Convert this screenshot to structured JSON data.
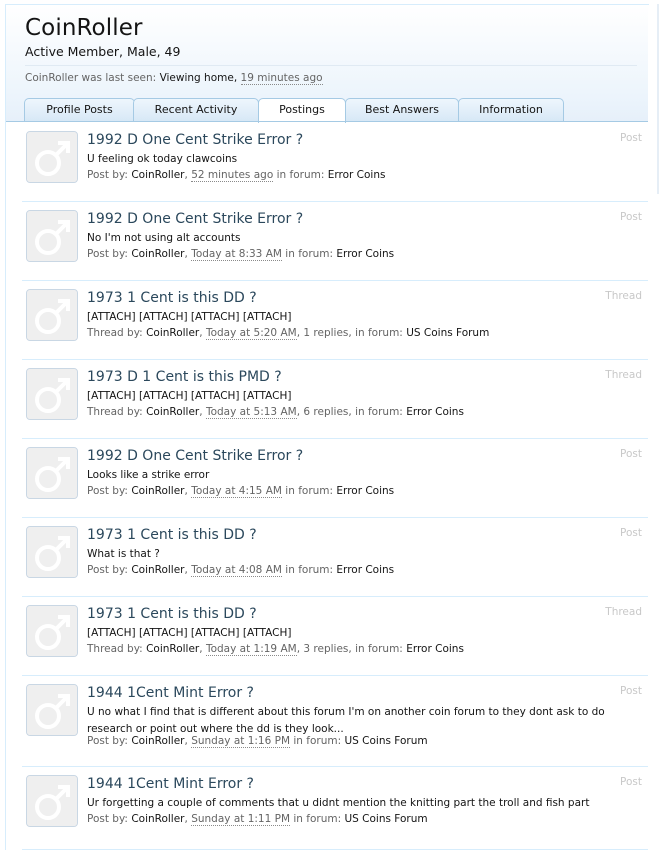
{
  "profile": {
    "username": "CoinRoller",
    "user_title": "Active Member, Male, 49",
    "last_seen_prefix": "CoinRoller was last seen:",
    "last_seen_activity": "Viewing home,",
    "last_seen_time": "19 minutes ago"
  },
  "tabs": [
    {
      "label": "Profile Posts"
    },
    {
      "label": "Recent Activity"
    },
    {
      "label": "Postings"
    },
    {
      "label": "Best Answers"
    },
    {
      "label": "Information"
    }
  ],
  "active_tab": "Postings",
  "items": [
    {
      "title": "1992 D One Cent Strike Error ?",
      "snippet": "U feeling ok today clawcoins",
      "by_label": "Post by:",
      "author": "CoinRoller",
      "time": "52 minutes ago",
      "replies": "",
      "forum_label": "in forum:",
      "forum": "Error Coins",
      "type": "Post"
    },
    {
      "title": "1992 D One Cent Strike Error ?",
      "snippet": "No I'm not using alt accounts",
      "by_label": "Post by:",
      "author": "CoinRoller",
      "time": "Today at 8:33 AM",
      "replies": "",
      "forum_label": "in forum:",
      "forum": "Error Coins",
      "type": "Post"
    },
    {
      "title": "1973 1 Cent is this DD ?",
      "snippet": "[ATTACH] [ATTACH] [ATTACH] [ATTACH]",
      "by_label": "Thread by:",
      "author": "CoinRoller",
      "time": "Today at 5:20 AM",
      "replies": "1 replies,",
      "forum_label": "in forum:",
      "forum": "US Coins Forum",
      "type": "Thread"
    },
    {
      "title": "1973 D 1 Cent is this PMD ?",
      "snippet": "[ATTACH] [ATTACH] [ATTACH] [ATTACH]",
      "by_label": "Thread by:",
      "author": "CoinRoller",
      "time": "Today at 5:13 AM",
      "replies": "6 replies,",
      "forum_label": "in forum:",
      "forum": "Error Coins",
      "type": "Thread"
    },
    {
      "title": "1992 D One Cent Strike Error ?",
      "snippet": "Looks like a strike error",
      "by_label": "Post by:",
      "author": "CoinRoller",
      "time": "Today at 4:15 AM",
      "replies": "",
      "forum_label": "in forum:",
      "forum": "Error Coins",
      "type": "Post"
    },
    {
      "title": "1973 1 Cent is this DD ?",
      "snippet": "What is that ?",
      "by_label": "Post by:",
      "author": "CoinRoller",
      "time": "Today at 4:08 AM",
      "replies": "",
      "forum_label": "in forum:",
      "forum": "Error Coins",
      "type": "Post"
    },
    {
      "title": "1973 1 Cent is this DD ?",
      "snippet": "[ATTACH] [ATTACH] [ATTACH] [ATTACH]",
      "by_label": "Thread by:",
      "author": "CoinRoller",
      "time": "Today at 1:19 AM",
      "replies": "3 replies,",
      "forum_label": "in forum:",
      "forum": "Error Coins",
      "type": "Thread"
    },
    {
      "title": "1944 1Cent Mint Error ?",
      "snippet": "U no what I find that is different about this forum I'm on another coin forum to they dont ask to do research or point out where the dd is they look...",
      "by_label": "Post by:",
      "author": "CoinRoller",
      "time": "Sunday at 1:16 PM",
      "replies": "",
      "forum_label": "in forum:",
      "forum": "US Coins Forum",
      "type": "Post"
    },
    {
      "title": "1944 1Cent Mint Error ?",
      "snippet": "Ur forgetting a couple of comments that u didnt mention the knitting part the troll and fish part",
      "by_label": "Post by:",
      "author": "CoinRoller",
      "time": "Sunday at 1:11 PM",
      "replies": "",
      "forum_label": "in forum:",
      "forum": "US Coins Forum",
      "type": "Post"
    }
  ]
}
